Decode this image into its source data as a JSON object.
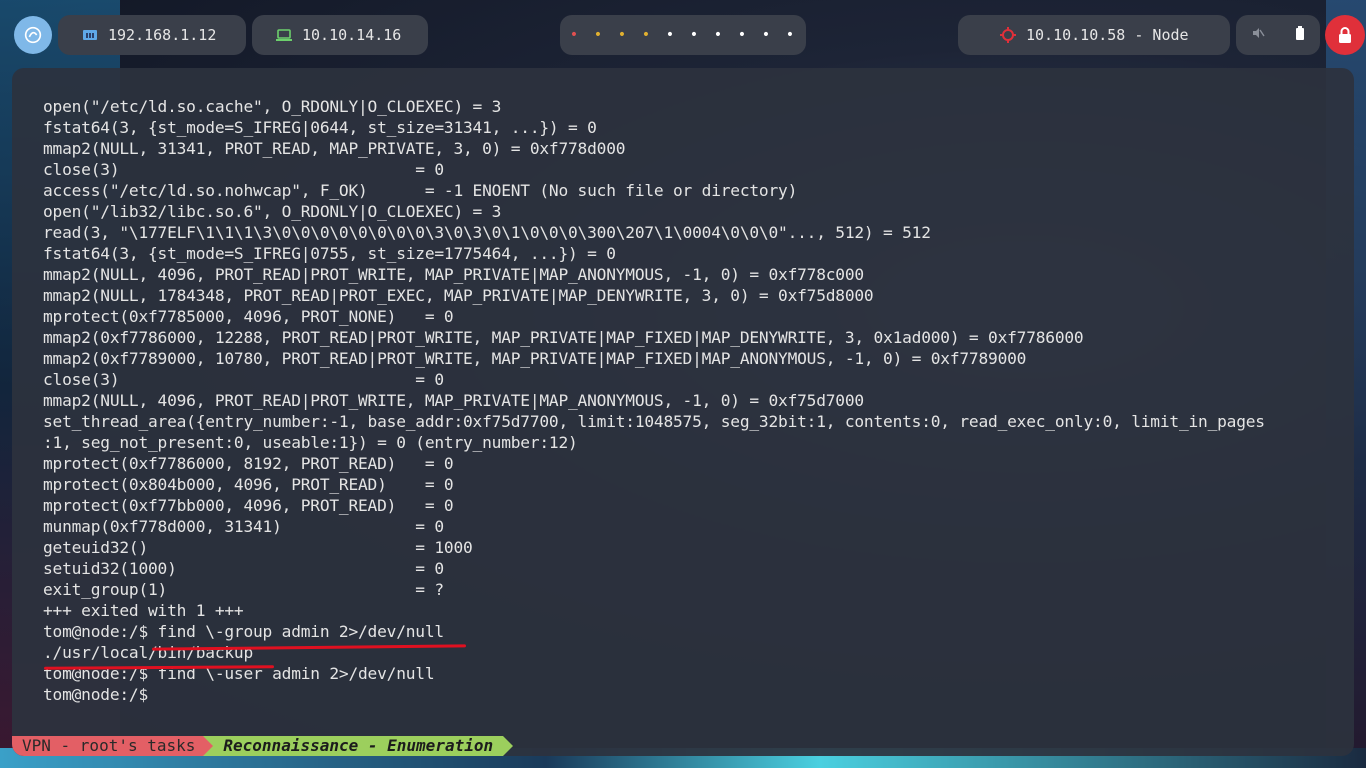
{
  "topbar": {
    "launcher_icon": "arch-swirl-icon",
    "ip_local": "192.168.1.12",
    "ip_vpn": "10.10.14.16",
    "workspaces": [
      "•",
      "•",
      "•",
      "•",
      "•",
      "•",
      "•",
      "•",
      "•",
      "•"
    ],
    "workspace_colors": [
      "#e05050",
      "#e0b030",
      "#e0b030",
      "#e0b030",
      "#ffffff",
      "#ffffff",
      "#ffffff",
      "#ffffff",
      "#ffffff",
      "#ffffff"
    ],
    "target": "10.10.10.58 - Node",
    "accent_color": "#e0303a"
  },
  "terminal": {
    "lines": [
      "open(\"/etc/ld.so.cache\", O_RDONLY|O_CLOEXEC) = 3",
      "fstat64(3, {st_mode=S_IFREG|0644, st_size=31341, ...}) = 0",
      "mmap2(NULL, 31341, PROT_READ, MAP_PRIVATE, 3, 0) = 0xf778d000",
      "close(3)                               = 0",
      "access(\"/etc/ld.so.nohwcap\", F_OK)      = -1 ENOENT (No such file or directory)",
      "open(\"/lib32/libc.so.6\", O_RDONLY|O_CLOEXEC) = 3",
      "read(3, \"\\177ELF\\1\\1\\1\\3\\0\\0\\0\\0\\0\\0\\0\\0\\3\\0\\3\\0\\1\\0\\0\\0\\300\\207\\1\\0004\\0\\0\\0\"..., 512) = 512",
      "fstat64(3, {st_mode=S_IFREG|0755, st_size=1775464, ...}) = 0",
      "mmap2(NULL, 4096, PROT_READ|PROT_WRITE, MAP_PRIVATE|MAP_ANONYMOUS, -1, 0) = 0xf778c000",
      "mmap2(NULL, 1784348, PROT_READ|PROT_EXEC, MAP_PRIVATE|MAP_DENYWRITE, 3, 0) = 0xf75d8000",
      "mprotect(0xf7785000, 4096, PROT_NONE)   = 0",
      "mmap2(0xf7786000, 12288, PROT_READ|PROT_WRITE, MAP_PRIVATE|MAP_FIXED|MAP_DENYWRITE, 3, 0x1ad000) = 0xf7786000",
      "mmap2(0xf7789000, 10780, PROT_READ|PROT_WRITE, MAP_PRIVATE|MAP_FIXED|MAP_ANONYMOUS, -1, 0) = 0xf7789000",
      "close(3)                               = 0",
      "mmap2(NULL, 4096, PROT_READ|PROT_WRITE, MAP_PRIVATE|MAP_ANONYMOUS, -1, 0) = 0xf75d7000",
      "set_thread_area({entry_number:-1, base_addr:0xf75d7700, limit:1048575, seg_32bit:1, contents:0, read_exec_only:0, limit_in_pages",
      ":1, seg_not_present:0, useable:1}) = 0 (entry_number:12)",
      "mprotect(0xf7786000, 8192, PROT_READ)   = 0",
      "mprotect(0x804b000, 4096, PROT_READ)    = 0",
      "mprotect(0xf77bb000, 4096, PROT_READ)   = 0",
      "munmap(0xf778d000, 31341)              = 0",
      "geteuid32()                            = 1000",
      "setuid32(1000)                         = 0",
      "exit_group(1)                          = ?",
      "+++ exited with 1 +++",
      "tom@node:/$ find \\-group admin 2>/dev/null",
      "./usr/local/bin/backup",
      "tom@node:/$ find \\-user admin 2>/dev/null",
      "tom@node:/$ "
    ],
    "annotation_color": "#e01020"
  },
  "statusbar": {
    "session": "VPN - root's tasks",
    "window": "Reconnaissance - Enumeration",
    "session_color": "#e35f65",
    "window_color": "#9ccf5d"
  }
}
